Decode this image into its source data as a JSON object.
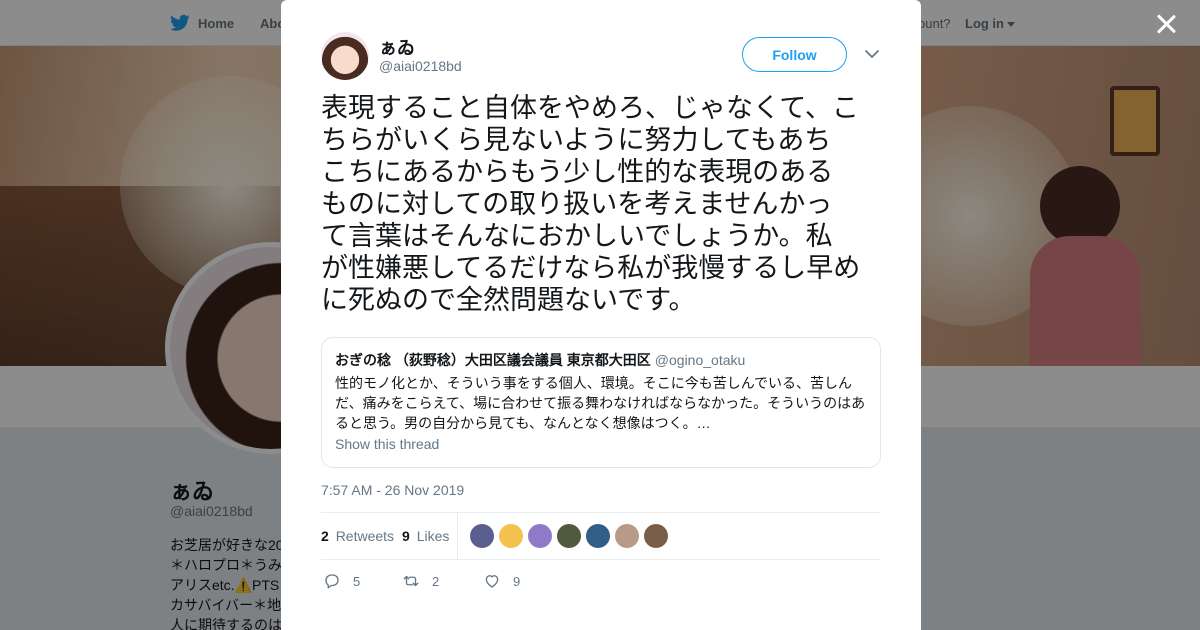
{
  "nav": {
    "home_label": "Home",
    "about_label": "Abo",
    "account_prompt": "ccount?",
    "login_label": "Log in",
    "brand_color": "#1da1f2"
  },
  "profile": {
    "name": "ぁゐ",
    "handle": "@aiai0218bd",
    "bio_lines": [
      "お芝居が好きな20",
      "＊ハロプロ＊うみ",
      "アリスetc.⚠️PTS",
      "カサバイバー＊地",
      "人に期待するのは"
    ]
  },
  "tweet": {
    "author_name": "ぁゐ",
    "author_handle": "@aiai0218bd",
    "follow_label": "Follow",
    "text_lines": [
      "表現すること自体をやめろ、じゃなくて、こ",
      "ちらがいくら見ないように努力してもあち",
      "こちにあるからもう少し性的な表現のある",
      "ものに対しての取り扱いを考えませんかっ",
      "て言葉はそんなにおかしいでしょうか。私",
      "が性嫌悪してるだけなら私が我慢するし早め",
      "に死ぬので全然問題ないです。"
    ],
    "quote": {
      "name": "おぎの稔 （荻野稔）大田区議会議員 東京都大田区",
      "handle": "@ogino_otaku",
      "text": "性的モノ化とか、そういう事をする個人、環境。そこに今も苦しんでいる、苦しんだ、痛みをこらえて、場に合わせて振る舞わなければならなかった。そういうのはあると思う。男の自分から見ても、なんとなく想像はつく。…",
      "thread_link": "Show this thread"
    },
    "timestamp": "7:57 AM - 26 Nov 2019",
    "retweets_count": "2",
    "retweets_label": "Retweets",
    "likes_count": "9",
    "likes_label": "Likes",
    "likers": [
      "#5b5f8f",
      "#f2c14e",
      "#8f7ac9",
      "#4f5a3e",
      "#2f5f86",
      "#b89a8a",
      "#7a5e4a"
    ],
    "actions": {
      "reply_count": "5",
      "retweet_count": "2",
      "like_count": "9"
    }
  }
}
